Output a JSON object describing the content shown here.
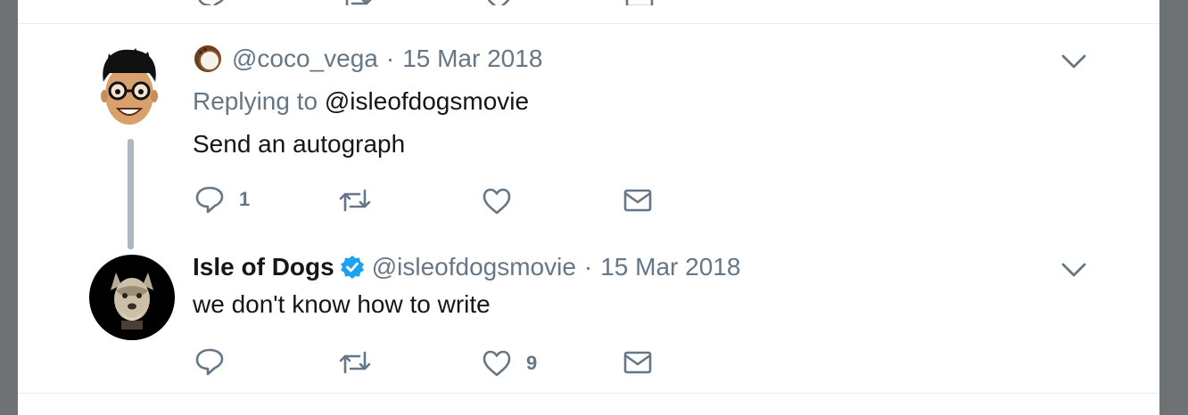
{
  "tweets": [
    {
      "handle": "@coco_vega",
      "separator": "·",
      "date": "15 Mar 2018",
      "replying_prefix": "Replying to",
      "replying_to": "@isleofdogsmovie",
      "text": "Send an autograph",
      "reply_count": "1",
      "retweet_count": "",
      "like_count": "",
      "avatar_icon": "cartoon-face-with-glasses-avatar",
      "emoji_icon": "coconut-emoji-icon"
    },
    {
      "display_name": "Isle of Dogs",
      "verified_icon": "verified-badge-icon",
      "handle": "@isleofdogsmovie",
      "separator": "·",
      "date": "15 Mar 2018",
      "text": "we don't know how to write",
      "reply_count": "",
      "retweet_count": "",
      "like_count": "9",
      "avatar_icon": "dog-avatar"
    }
  ],
  "colors": {
    "text_primary": "#14171a",
    "text_secondary": "#657786",
    "verified": "#1da1f2",
    "thread_line": "#aab8c2",
    "divider": "#e6ecf0",
    "background": "#6e7275"
  }
}
